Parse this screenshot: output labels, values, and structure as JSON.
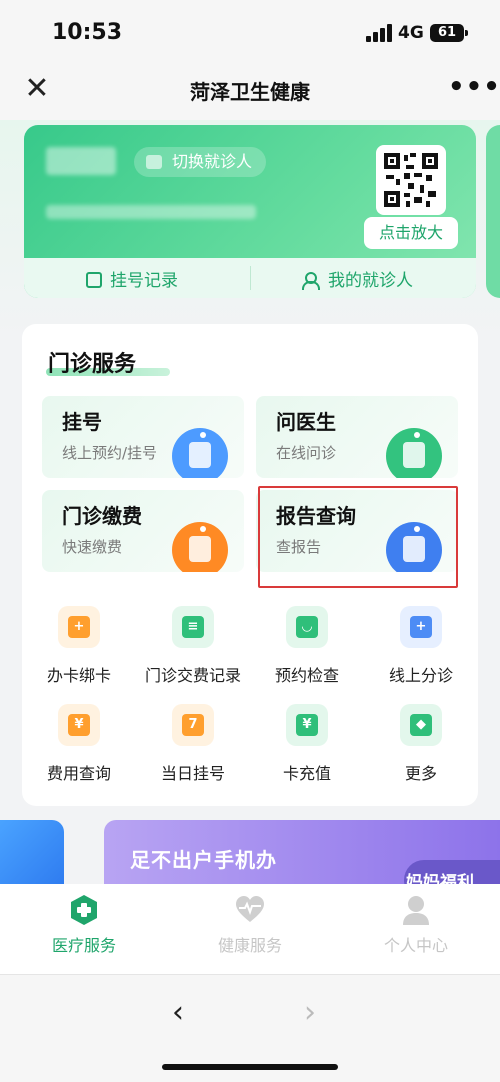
{
  "status": {
    "time": "10:53",
    "network": "4G",
    "battery": "61"
  },
  "nav": {
    "title": "菏泽卫生健康",
    "close_symbol": "✕",
    "more_symbol": "•••"
  },
  "card": {
    "switch_label": "切换就诊人",
    "zoom_label": "点击放大",
    "actions": [
      {
        "label": "挂号记录",
        "icon": "document-icon"
      },
      {
        "label": "我的就诊人",
        "icon": "people-icon"
      }
    ]
  },
  "outpatient": {
    "title": "门诊服务",
    "tiles": [
      {
        "title": "挂号",
        "subtitle": "线上预约/挂号",
        "color": "#4d9bff"
      },
      {
        "title": "问医生",
        "subtitle": "在线问诊",
        "color": "#33c37f"
      },
      {
        "title": "门诊缴费",
        "subtitle": "快速缴费",
        "color": "#ff8a24"
      },
      {
        "title": "报告查询",
        "subtitle": "查报告",
        "color": "#3f7ff0"
      }
    ],
    "grid": [
      {
        "label": "办卡绑卡",
        "icon": "card-plus-icon",
        "bg": "#fff2e0",
        "fg": "#ff9f2e",
        "sym": "+"
      },
      {
        "label": "门诊交费记录",
        "icon": "record-edit-icon",
        "bg": "#e3f7ec",
        "fg": "#2fbf7a",
        "sym": "≡"
      },
      {
        "label": "预约检查",
        "icon": "ultrasound-icon",
        "bg": "#e3f7ec",
        "fg": "#2fbf7a",
        "sym": "◡"
      },
      {
        "label": "线上分诊",
        "icon": "hospital-icon",
        "bg": "#e6efff",
        "fg": "#4d8cf5",
        "sym": "+"
      },
      {
        "label": "费用查询",
        "icon": "fee-icon",
        "bg": "#fff2e0",
        "fg": "#ff9f2e",
        "sym": "¥"
      },
      {
        "label": "当日挂号",
        "icon": "calendar-icon",
        "bg": "#fff2e0",
        "fg": "#ff9f2e",
        "sym": "7"
      },
      {
        "label": "卡充值",
        "icon": "recharge-icon",
        "bg": "#e3f7ec",
        "fg": "#2fbf7a",
        "sym": "¥"
      },
      {
        "label": "更多",
        "icon": "apps-icon",
        "bg": "#e3f7ec",
        "fg": "#2fbf7a",
        "sym": "◆"
      }
    ]
  },
  "banner": {
    "text": "足不出户手机办",
    "pill": "妈妈福利"
  },
  "tabs": [
    {
      "label": "医疗服务",
      "active": true
    },
    {
      "label": "健康服务",
      "active": false
    },
    {
      "label": "个人中心",
      "active": false
    }
  ],
  "browser": {
    "back": "‹",
    "forward": "›"
  },
  "colors": {
    "accent": "#1fa56b",
    "tab_inactive": "#c6c6c6"
  }
}
